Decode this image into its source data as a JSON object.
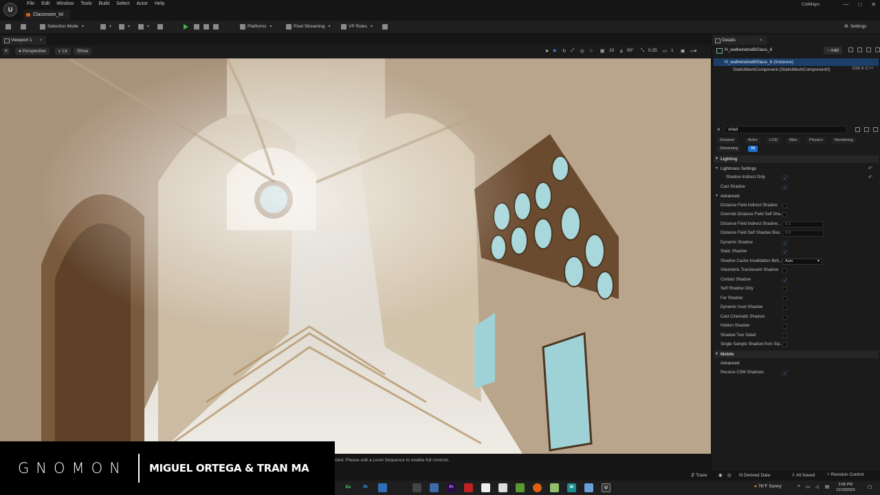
{
  "window": {
    "menu": [
      "File",
      "Edit",
      "Window",
      "Tools",
      "Build",
      "Select",
      "Actor",
      "Help"
    ],
    "level_tab": "Classroom_lvl",
    "username": "CotMayo",
    "controls": [
      "—",
      "□",
      "✕"
    ]
  },
  "toolbar": {
    "selection_mode": "Selection Mode",
    "platforms": "Platforms",
    "pixel_streaming": "Pixel Streaming",
    "vp_roles": "VP Roles",
    "settings": "Settings"
  },
  "viewport": {
    "tab": "Viewport 1",
    "perspective": "Perspective",
    "lit": "Lit",
    "show": "Show",
    "grid_snap": "10",
    "rot_snap": "90°",
    "scale_snap": "0.25",
    "camera_speed": "1",
    "sequence_message": "cted. Please edit a Level Sequence to enable full controls."
  },
  "details": {
    "tab": "Details",
    "actor_name": "H_wallwindowBGlass_6",
    "add_label": "Add",
    "components": [
      {
        "label": "H_wallwindowBGlass_6 (Instance)"
      },
      {
        "label": "StaticMeshComponent (StaticMeshComponent0)"
      }
    ],
    "edit_cpp": "Edit in C++",
    "search_value": "shad",
    "filter_tabs": [
      "General",
      "Actor",
      "LOD",
      "Misc",
      "Physics",
      "Rendering",
      "Streaming",
      "All"
    ],
    "categories": {
      "lighting": "Lighting",
      "lightmass": "Lightmass Settings",
      "advanced": "Advanced",
      "mobile": "Mobile",
      "mobile_advanced": "Advanced"
    },
    "lightmass_props": [
      {
        "label": "Shadow Indirect Only",
        "checked": true
      }
    ],
    "lighting_props": [
      {
        "label": "Cast Shadow",
        "checked": true
      }
    ],
    "advanced_props": [
      {
        "label": "Distance Field Indirect Shadow",
        "checked": false
      },
      {
        "label": "Override Distance Field Self Sha...",
        "checked": false
      },
      {
        "label": "Distance Field Indirect Shadow...",
        "value": "0.1"
      },
      {
        "label": "Distance Field Self Shadow Bias",
        "value": "0.0"
      },
      {
        "label": "Dynamic Shadow",
        "checked": true
      },
      {
        "label": "Static Shadow",
        "checked": true
      },
      {
        "label": "Shadow Cache Invalidation Beh...",
        "dropdown": "Auto"
      },
      {
        "label": "Volumetric Translucent Shadow",
        "checked": false
      },
      {
        "label": "Contact Shadow",
        "checked": true
      },
      {
        "label": "Self Shadow Only",
        "checked": false
      },
      {
        "label": "Far Shadow",
        "checked": false
      },
      {
        "label": "Dynamic Inset Shadow",
        "checked": false
      },
      {
        "label": "Cast Cinematic Shadow",
        "checked": false
      },
      {
        "label": "Hidden Shadow",
        "checked": false
      },
      {
        "label": "Shadow Two Sided",
        "checked": false
      },
      {
        "label": "Single Sample Shadow from Sta...",
        "checked": false
      }
    ],
    "mobile_props": [
      {
        "label": "Receive CSM Shadows",
        "checked": true
      }
    ]
  },
  "statusbar": {
    "trace": "Trace",
    "derived_data": "Derived Data",
    "all_saved": "All Saved",
    "revision_control": "Revision Control"
  },
  "taskbar": {
    "weather": "76°F  Sunny",
    "time": "3:06 PM",
    "date": "12/15/2023",
    "apps": [
      "Ds",
      "Pt",
      "",
      "",
      "",
      "Pr",
      "",
      "",
      "",
      "",
      "",
      "",
      "M",
      "",
      "U"
    ]
  },
  "banner": {
    "brand": "GNOMON",
    "presenters": "MIGUEL ORTEGA & TRAN MA"
  },
  "colors": {
    "accent": "#1f6fd1",
    "selection": "#1c3f6a",
    "play": "#3fb34f"
  }
}
